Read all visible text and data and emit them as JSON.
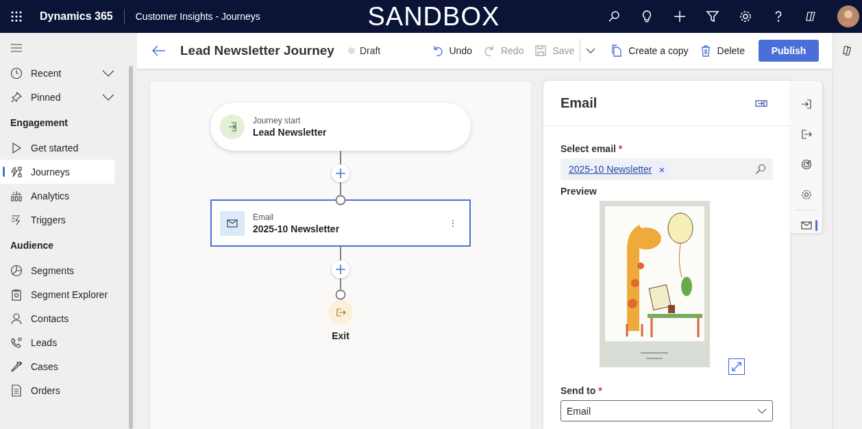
{
  "top_bar": {
    "app_name": "Dynamics 365",
    "area": "Customer Insights - Journeys",
    "environment": "SANDBOX"
  },
  "sidebar": {
    "top_items": [
      {
        "label": "Recent",
        "expanded": false
      },
      {
        "label": "Pinned",
        "expanded": false
      }
    ],
    "sections": [
      {
        "title": "Engagement",
        "items": [
          {
            "label": "Get started",
            "selected": false
          },
          {
            "label": "Journeys",
            "selected": true
          },
          {
            "label": "Analytics",
            "selected": false
          },
          {
            "label": "Triggers",
            "selected": false
          }
        ]
      },
      {
        "title": "Audience",
        "items": [
          {
            "label": "Segments",
            "selected": false
          },
          {
            "label": "Segment Explorer",
            "selected": false
          },
          {
            "label": "Contacts",
            "selected": false
          },
          {
            "label": "Leads",
            "selected": false
          },
          {
            "label": "Cases",
            "selected": false
          },
          {
            "label": "Orders",
            "selected": false
          }
        ]
      }
    ]
  },
  "header": {
    "title": "Lead Newsletter Journey",
    "status": "Draft"
  },
  "toolbar": [
    {
      "label": "Undo",
      "disabled": false
    },
    {
      "label": "Redo",
      "disabled": true
    },
    {
      "label": "Save",
      "disabled": true
    },
    {
      "label": "Create a copy",
      "disabled": false
    },
    {
      "label": "Delete",
      "disabled": false
    }
  ],
  "publish_button": "Publish",
  "canvas": {
    "start": {
      "caption": "Journey start",
      "name": "Lead Newsletter"
    },
    "steps": [
      {
        "caption": "Email",
        "name": "2025-10 Newsletter",
        "selected": true
      }
    ],
    "exit": "Exit"
  },
  "panel": {
    "title": "Email",
    "select_email": {
      "label": "Select email",
      "required_mark": "*",
      "value": "2025-10 Newsletter",
      "remove": "×"
    },
    "preview_label": "Preview",
    "send_to": {
      "label": "Send to",
      "required_mark": "*",
      "value": "Email"
    }
  },
  "rail_tabs": [
    {
      "selected": false
    },
    {
      "selected": false
    },
    {
      "selected": false
    },
    {
      "selected": false
    },
    {
      "selected": true
    }
  ]
}
